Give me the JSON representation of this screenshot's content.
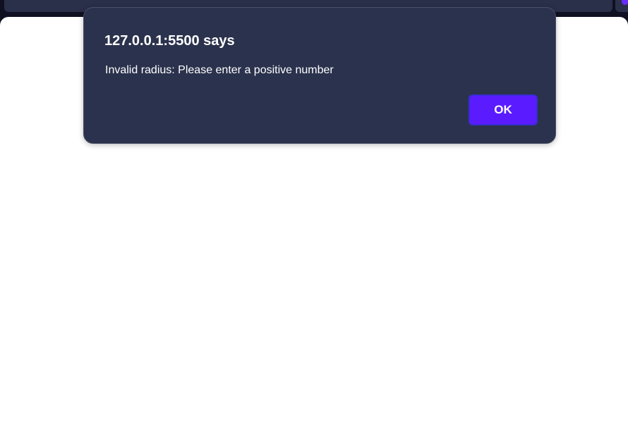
{
  "dialog": {
    "title": "127.0.0.1:5500 says",
    "message": "Invalid radius: Please enter a positive number",
    "ok_label": "OK"
  },
  "colors": {
    "dialog_background": "#2b324d",
    "ok_button": "#5a1cff",
    "browser_chrome": "#0f1022",
    "page_background": "#ffffff"
  }
}
